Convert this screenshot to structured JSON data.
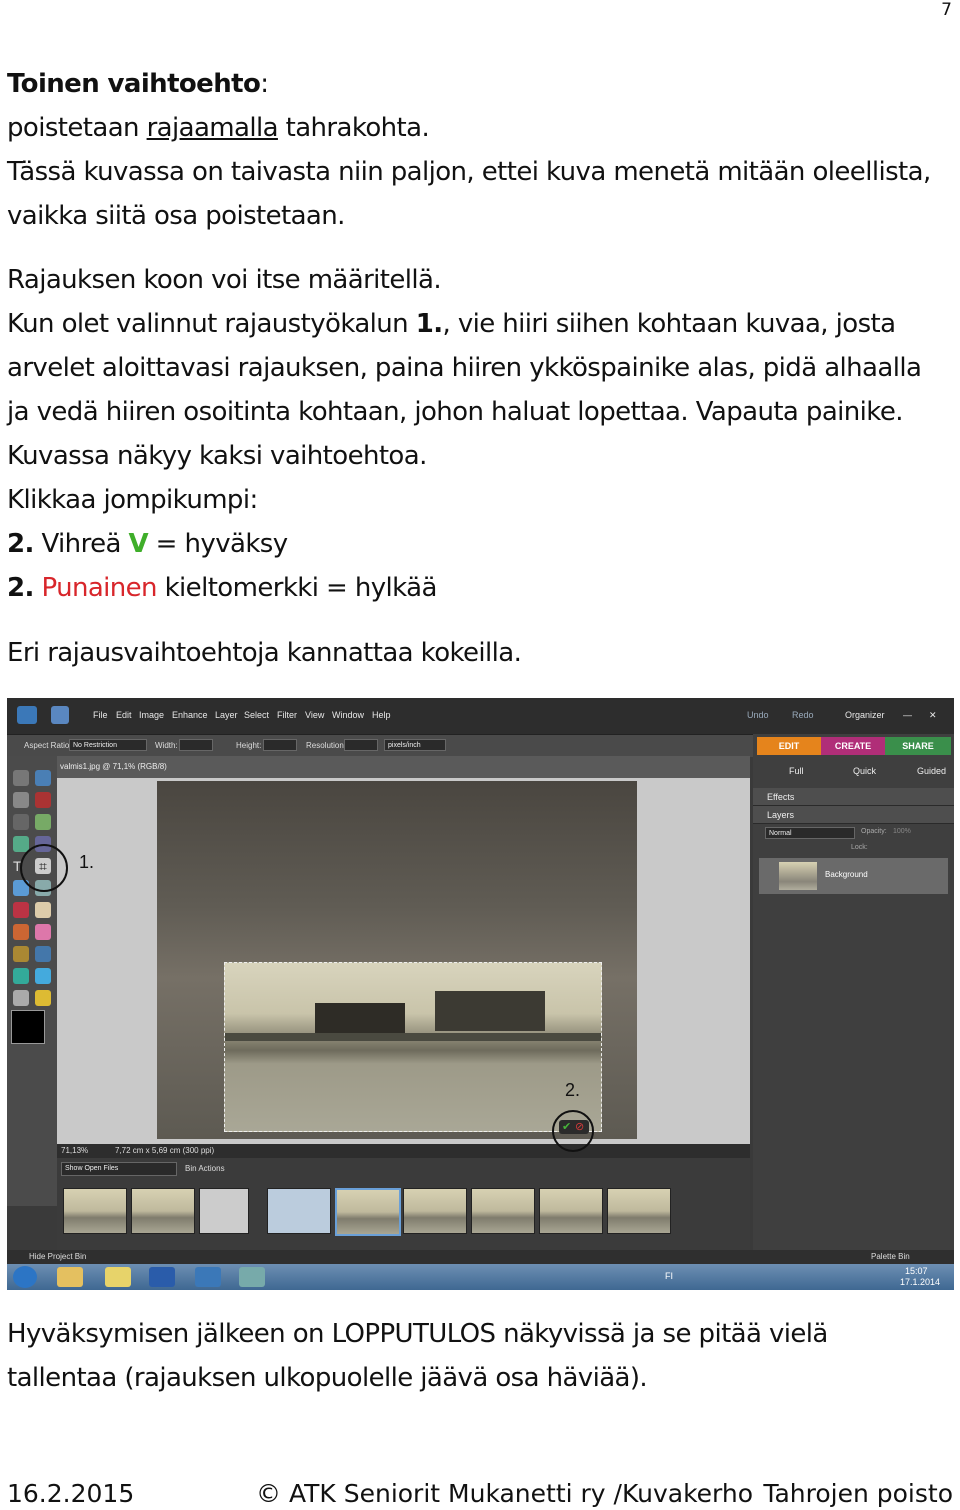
{
  "page_number": "7",
  "heading": "Toinen vaihtoehto",
  "heading_colon": ":",
  "line1_pre": "poistetaan ",
  "line1_link": "rajaamalla",
  "line1_post": " tahrakohta.",
  "line2": "Tässä kuvassa on taivasta niin paljon, ettei kuva  menetä mitään oleellista,",
  "line3": "vaikka siitä osa poistetaan.",
  "line4": "Rajauksen koon voi itse määritellä.",
  "line5_pre": "Kun olet valinnut rajaustyökalun ",
  "line5_bold": "1.",
  "line5_post": ", vie hiiri siihen kohtaan kuvaa, josta",
  "line6": "arvelet aloittavasi rajauksen, paina hiiren ykköspainike alas,  pidä alhaalla",
  "line7": "ja vedä hiiren osoitinta kohtaan, johon haluat lopettaa. Vapauta painike.",
  "line8": "Kuvassa näkyy  kaksi vaihtoehtoa.",
  "line9": "Klikkaa  jompikumpi:",
  "line10_num": "2.",
  "line10_pre": " Vihreä ",
  "line10_v": "V",
  "line10_post": "  = hyväksy",
  "line11_num": "2.",
  "line11_red": " Punainen",
  "line11_post": " kieltomerkki = hylkää",
  "line12": "Eri rajausvaihtoehtoja kannattaa kokeilla.",
  "after1": "Hyväksymisen jälkeen on LOPPUTULOS  näkyvissä  ja se pitää vielä",
  "after2": "tallentaa (rajauksen ulkopuolelle jäävä osa häviää).",
  "footer_date": "16.2.2015",
  "footer_center": "© ATK Seniorit Mukanetti ry /Kuvakerho",
  "footer_right": "Tahrojen poisto",
  "screenshot": {
    "menu": [
      "File",
      "Edit",
      "Image",
      "Enhance",
      "Layer",
      "Select",
      "Filter",
      "View",
      "Window",
      "Help"
    ],
    "undo": "Undo",
    "redo": "Redo",
    "organizer": "Organizer",
    "aspect_label": "Aspect Ratio:",
    "aspect_value": "No Restriction",
    "width_label": "Width:",
    "height_label": "Height:",
    "resolution_label": "Resolution:",
    "resolution_unit": "pixels/inch",
    "tab_edit": "EDIT",
    "tab_create": "CREATE",
    "tab_share": "SHARE",
    "mode_full": "Full",
    "mode_quick": "Quick",
    "mode_guided": "Guided",
    "effects": "Effects",
    "layers": "Layers",
    "blend": "Normal",
    "opacity": "Opacity:",
    "opacity_val": "100%",
    "lock": "Lock:",
    "layer_name": "Background",
    "doc_title": "valmis1.jpg @ 71,1% (RGB/8)",
    "zoom": "71,13%",
    "docsize": "7,72 cm x 5,69 cm (300 ppi)",
    "show_open": "Show Open Files",
    "bin_actions": "Bin Actions",
    "hide_bin": "Hide Project Bin",
    "palette_bin": "Palette Bin",
    "time": "15:07",
    "date": "17.1.2014",
    "lang": "FI",
    "label1": "1.",
    "label2": "2.",
    "close_glyph": "✕",
    "min_glyph": "—",
    "check_glyph": "✔",
    "cancel_glyph": "⊘",
    "crop_glyph": "⌗",
    "colors": {
      "edit": "#e5841c",
      "create": "#b02e78",
      "share": "#3a8f4b",
      "accept": "#47b33a",
      "reject": "#d23b3b"
    }
  }
}
